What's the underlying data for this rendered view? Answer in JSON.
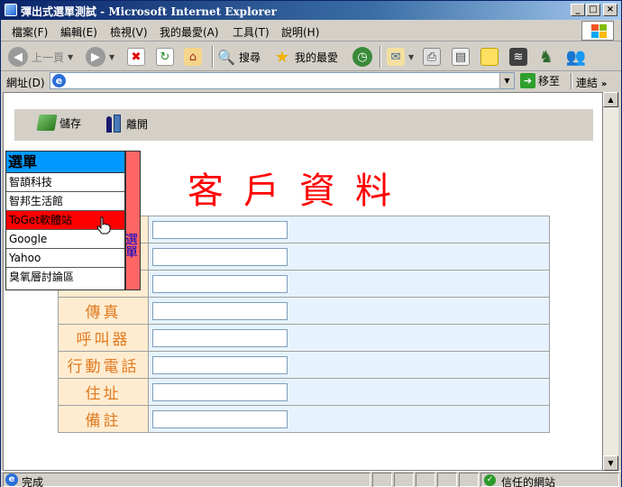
{
  "window": {
    "title": "彈出式選單測試 - Microsoft Internet Explorer",
    "min": "_",
    "max": "□",
    "close": "×"
  },
  "menubar": {
    "items": [
      "檔案(F)",
      "編輯(E)",
      "檢視(V)",
      "我的最愛(A)",
      "工具(T)",
      "說明(H)"
    ]
  },
  "toolbar": {
    "back_label": "上一頁",
    "search_label": "搜尋",
    "favorites_label": "我的最愛"
  },
  "address": {
    "label": "網址(D)",
    "value": "",
    "go_label": "移至",
    "links_label": "連結"
  },
  "page": {
    "save_label": "儲存",
    "leave_label": "離開",
    "heading": "客戶資料",
    "fields": [
      {
        "label": "",
        "value": ""
      },
      {
        "label": "",
        "value": ""
      },
      {
        "label": "",
        "value": ""
      },
      {
        "label": "傳真",
        "value": ""
      },
      {
        "label": "呼叫器",
        "value": ""
      },
      {
        "label": "行動電話",
        "value": ""
      },
      {
        "label": "住址",
        "value": ""
      },
      {
        "label": "備註",
        "value": ""
      }
    ]
  },
  "popup": {
    "header": "選單",
    "tab_label": "選單",
    "items": [
      "智頡科技",
      "智邦生活館",
      "ToGet軟體站",
      "Google",
      "Yahoo",
      "臭氧層討論區"
    ],
    "active_index": 2
  },
  "status": {
    "text": "完成",
    "zone": "信任的網站"
  }
}
